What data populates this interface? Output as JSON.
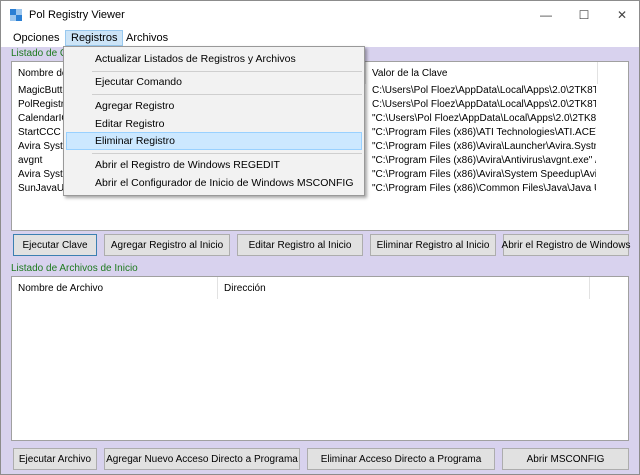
{
  "window": {
    "title": "Pol Registry Viewer",
    "controls": {
      "minimize": "—",
      "maximize": "☐",
      "close": "✕"
    }
  },
  "menubar": [
    {
      "label": "Opciones"
    },
    {
      "label": "Registros"
    },
    {
      "label": "Archivos"
    }
  ],
  "registros_menu": {
    "items": [
      "Actualizar Listados de Registros y Archivos",
      "Ejecutar Comando",
      "Agregar Registro",
      "Editar Registro",
      "Eliminar Registro",
      "Abrir el Registro de Windows REGEDIT",
      "Abrir el Configurador de Inicio de Windows MSCONFIG"
    ],
    "highlighted": "Eliminar Registro"
  },
  "claves": {
    "group_label": "Listado de Cla",
    "columns": [
      "Nombre de",
      "Valor de la Clave"
    ],
    "rows": [
      {
        "name": "MagicButto",
        "value": "C:\\Users\\Pol Floez\\AppData\\Local\\Apps\\2.0\\2TK8T..."
      },
      {
        "name": "PolRegistry\\",
        "value": "C:\\Users\\Pol Floez\\AppData\\Local\\Apps\\2.0\\2TK8T..."
      },
      {
        "name": "CalendarIO",
        "value": "\"C:\\Users\\Pol Floez\\AppData\\Local\\Apps\\2.0\\2TK8..."
      },
      {
        "name": "StartCCC",
        "value": "\"C:\\Program Files (x86)\\ATI Technologies\\ATI.ACE\\C..."
      },
      {
        "name": "Avira Systra",
        "value": "\"C:\\Program Files (x86)\\Avira\\Launcher\\Avira.Systray..."
      },
      {
        "name": "avgnt",
        "value": "\"C:\\Program Files (x86)\\Avira\\Antivirus\\avgnt.exe\" /min"
      },
      {
        "name": "Avira Systen",
        "value": "\"C:\\Program Files (x86)\\Avira\\System Speedup\\Avira...."
      },
      {
        "name": "SunJavaUp",
        "value": "\"C:\\Program Files (x86)\\Common Files\\Java\\Java Upd..."
      }
    ],
    "buttons": [
      "Ejecutar Clave",
      "Agregar Registro al Inicio",
      "Editar Registro al Inicio",
      "Eliminar Registro al Inicio",
      "Abrir el Registro de Windows"
    ]
  },
  "archivos": {
    "group_label": "Listado de Archivos de Inicio",
    "columns": [
      "Nombre de Archivo",
      "Dirección"
    ],
    "rows": [],
    "buttons": [
      "Ejecutar Archivo",
      "Agregar Nuevo Acceso Directo a Programa",
      "Eliminar Acceso Directo a Programa",
      "Abrir MSCONFIG"
    ]
  },
  "colors": {
    "window_bg": "#d8d2ee",
    "group_label": "#1e7a1e",
    "menu_highlight": "#cce8ff"
  }
}
